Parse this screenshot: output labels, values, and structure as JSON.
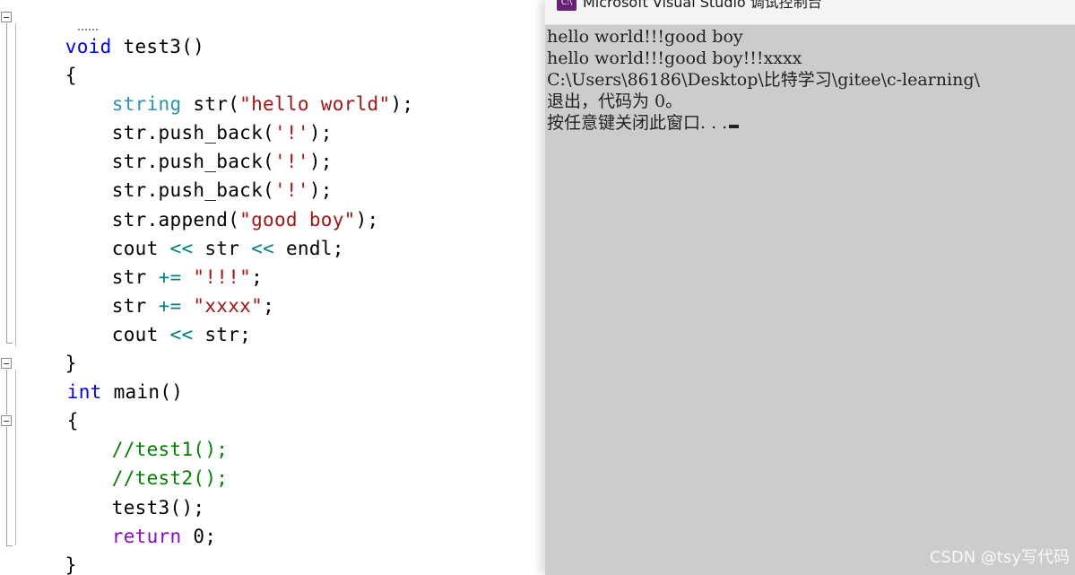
{
  "editor": {
    "lines": {
      "l1": {
        "t1": "void",
        "t2": " ",
        "t3": "test3",
        "t4": "()"
      },
      "l2": {
        "t1": "{"
      },
      "l3": {
        "t1": "string",
        "t2": " str(",
        "t3": "\"hello world\"",
        "t4": ");"
      },
      "l4": {
        "t1": "str.push_back(",
        "t2": "'!'",
        "t3": ");"
      },
      "l5": {
        "t1": "str.push_back(",
        "t2": "'!'",
        "t3": ");"
      },
      "l6": {
        "t1": "str.push_back(",
        "t2": "'!'",
        "t3": ");"
      },
      "l7": {
        "t1": "str.append(",
        "t2": "\"good boy\"",
        "t3": ");"
      },
      "l8": {
        "t1": "cout ",
        "t2": "<<",
        "t3": " str ",
        "t4": "<<",
        "t5": " endl;"
      },
      "l9": {
        "t1": "str ",
        "t2": "+=",
        "t3": " ",
        "t4": "\"!!!\"",
        "t5": ";"
      },
      "l10": {
        "t1": "str ",
        "t2": "+=",
        "t3": " ",
        "t4": "\"xxxx\"",
        "t5": ";"
      },
      "l11": {
        "t1": "cout ",
        "t2": "<<",
        "t3": " str;"
      },
      "l12": {
        "t1": "}"
      },
      "l13": {
        "t1": "int",
        "t2": " main()"
      },
      "l14": {
        "t1": "{"
      },
      "l15": {
        "t1": "//test1();"
      },
      "l16": {
        "t1": "//test2();"
      },
      "l17": {
        "t1": "test3();"
      },
      "l18": {
        "t1": "return",
        "t2": " 0;"
      },
      "l19": {
        "t1": "}"
      }
    }
  },
  "console": {
    "title": "Microsoft Visual Studio 调试控制台",
    "icon_label": "C:\\",
    "icon_name": "visual-studio-console-icon",
    "lines": [
      "hello world!!!good boy",
      "hello world!!!good boy!!!xxxx",
      "C:\\Users\\86186\\Desktop\\比特学习\\gitee\\c-learning\\",
      "退出，代码为 0。",
      "按任意键关闭此窗口. . ."
    ]
  },
  "watermark": "CSDN @tsy写代码",
  "colors": {
    "keyword": "#0000ff",
    "type": "#2b91af",
    "string": "#a31515",
    "comment": "#008000",
    "operator": "#008080",
    "control": "#8f08c4",
    "console_bg": "#cccccc"
  }
}
